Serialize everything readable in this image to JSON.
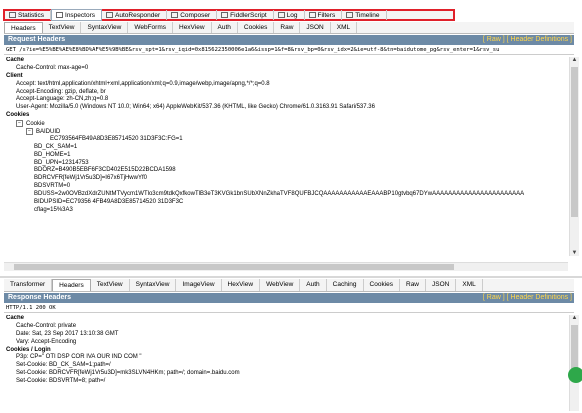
{
  "top_strip": "",
  "main_tabs": [
    {
      "label": "Statistics",
      "icon": "statistics-icon"
    },
    {
      "label": "Inspectors",
      "icon": "inspectors-icon",
      "active": true
    },
    {
      "label": "AutoResponder",
      "icon": "autoresponder-icon"
    },
    {
      "label": "Composer",
      "icon": "composer-icon"
    },
    {
      "label": "FiddlerScript",
      "icon": "fiddlerscript-icon"
    },
    {
      "label": "Log",
      "icon": "log-icon"
    },
    {
      "label": "Filters",
      "icon": "filters-icon"
    },
    {
      "label": "Timeline",
      "icon": "timeline-icon"
    }
  ],
  "request": {
    "tabs": [
      "Headers",
      "TextView",
      "SyntaxView",
      "WebForms",
      "HexView",
      "Auth",
      "Cookies",
      "Raw",
      "JSON",
      "XML"
    ],
    "active_tab": "Headers",
    "title": "Request Headers",
    "links": "[ Raw ]   [ Header Definitions ]",
    "request_line": "GET /s?ie=%E5%BE%AE%E8%BD%AF%E5%9B%BE&rsv_spt=1&rsv_iqid=0x815622350006e1a6&issp=1&f=8&rsv_bp=0&rsv_idx=2&ie=utf-8&tn=baidutome_pg&rsv_enter=1&rsv_su",
    "rows": [
      {
        "cls": "sec",
        "text": "Cache"
      },
      {
        "cls": "l1",
        "text": "Cache-Control: max-age=0"
      },
      {
        "cls": "sec",
        "text": "Client"
      },
      {
        "cls": "l1",
        "text": "Accept: text/html,application/xhtml+xml,application/xml;q=0.9,image/webp,image/apng,*/*;q=0.8"
      },
      {
        "cls": "l1",
        "text": "Accept-Encoding: gzip, deflate, br"
      },
      {
        "cls": "l1",
        "text": "Accept-Language: zh-CN,zh;q=0.8"
      },
      {
        "cls": "l1",
        "text": "User-Agent: Mozilla/5.0 (Windows NT 10.0; Win64; x64) AppleWebKit/537.36 (KHTML, like Gecko) Chrome/61.0.3163.91 Safari/537.36"
      },
      {
        "cls": "sec",
        "text": "Cookies"
      },
      {
        "cls": "l1 tree",
        "text": "Cookie",
        "toggle": "−"
      },
      {
        "cls": "l2 tree",
        "text": "BAIDUID",
        "toggle": "−"
      },
      {
        "cls": "l4",
        "text": "EC793564FB49A8D3E85714520 31D3F3C:FG=1"
      },
      {
        "cls": "l3",
        "text": "BD_CK_SAM=1"
      },
      {
        "cls": "l3",
        "text": "BD_HOME=1"
      },
      {
        "cls": "l3",
        "text": "BD_UPN=12314753"
      },
      {
        "cls": "l3",
        "text": "BDORZ=B490B5EBF6F3CD402E515D22BCDA1598"
      },
      {
        "cls": "l3",
        "text": "BDRCVFR[feWj1Vr5u3D]=I67x6TjHwwYf0"
      },
      {
        "cls": "l3",
        "text": "BDSVRTM=0"
      },
      {
        "cls": "l3",
        "text": "BDUSS=2w0OVBzdXdrZUNtMTVycm1WTlo3cm9tdkQxfkowTlB3eT3KVGk1bnSUbXNnZkhaTVF8QUFBJCQAAAAAAAAAAAEAAABP10gtvbq67DYwAAAAAAAAAAAAAAAAAAAAAAA"
      },
      {
        "cls": "l3",
        "text": "BIDUPSID=EC79356 4FB49A8D3E85714520 31D3F3C"
      },
      {
        "cls": "l3",
        "text": "cflag=15%3A3"
      }
    ]
  },
  "response": {
    "tabs": [
      "Transformer",
      "Headers",
      "TextView",
      "SyntaxView",
      "ImageView",
      "HexView",
      "WebView",
      "Auth",
      "Caching",
      "Cookies",
      "Raw",
      "JSON",
      "XML"
    ],
    "active_tab": "Headers",
    "title": "Response Headers",
    "links": "[ Raw ]   [ Header Definitions ]",
    "status_line": "HTTP/1.1 200 OK",
    "rows": [
      {
        "cls": "sec",
        "text": "Cache"
      },
      {
        "cls": "l1",
        "text": "Cache-Control: private"
      },
      {
        "cls": "l1",
        "text": "Date: Sat, 23 Sep 2017 13:10:38 GMT"
      },
      {
        "cls": "l1",
        "text": "Vary: Accept-Encoding"
      },
      {
        "cls": "sec",
        "text": "Cookies / Login"
      },
      {
        "cls": "l1",
        "text": "P3p: CP=\" OTI DSP COR IVA OUR IND COM \""
      },
      {
        "cls": "l1",
        "text": "Set-Cookie: BD_CK_SAM=1;path=/"
      },
      {
        "cls": "l1",
        "text": "Set-Cookie: BDRCVFR[feWj1Vr5u3D]=mk3SLVN4HKm; path=/; domain=.baidu.com"
      },
      {
        "cls": "l1",
        "text": "Set-Cookie: BDSVRTM=8; path=/"
      }
    ]
  },
  "badge_text": "",
  "colors": {
    "highlight_border": "#e0202a",
    "header_bar": "#6d8aa6",
    "header_links": "#ffd64a"
  }
}
